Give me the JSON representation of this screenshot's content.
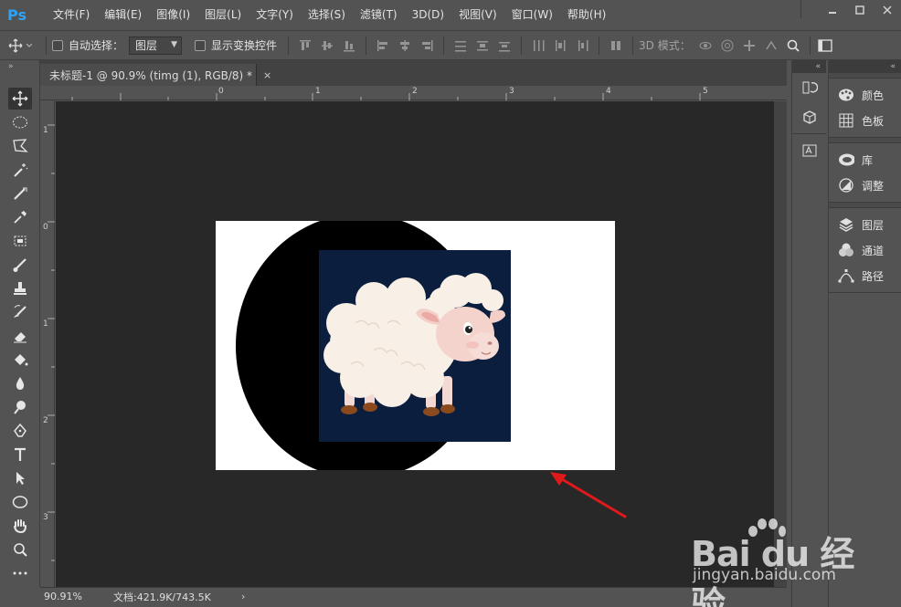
{
  "app": {
    "logo": "Ps",
    "menu": [
      "文件(F)",
      "编辑(E)",
      "图像(I)",
      "图层(L)",
      "文字(Y)",
      "选择(S)",
      "滤镜(T)",
      "3D(D)",
      "视图(V)",
      "窗口(W)",
      "帮助(H)"
    ]
  },
  "options": {
    "auto_select_label": "自动选择：",
    "layer_select_value": "图层",
    "show_transform_label": "显示变换控件",
    "mode_3d_label": "3D 模式："
  },
  "document_tab": {
    "title": "未标题-1 @ 90.9% (timg (1), RGB/8) *",
    "close": "×"
  },
  "rulers": {
    "top": [
      "0",
      "1",
      "2",
      "3",
      "4",
      "5"
    ],
    "left": [
      "1",
      "0",
      "1",
      "2",
      "3"
    ]
  },
  "status": {
    "zoom": "90.91%",
    "doc_info": "文档:421.9K/743.5K",
    "arrow": "›"
  },
  "panels": {
    "group1": [
      {
        "icon": "palette-icon",
        "label": "颜色"
      },
      {
        "icon": "swatches-icon",
        "label": "色板"
      }
    ],
    "group2": [
      {
        "icon": "libraries-icon",
        "label": "库"
      },
      {
        "icon": "adjustments-icon",
        "label": "调整"
      }
    ],
    "group3": [
      {
        "icon": "layers-icon",
        "label": "图层"
      },
      {
        "icon": "channels-icon",
        "label": "通道"
      },
      {
        "icon": "paths-icon",
        "label": "路径"
      }
    ]
  },
  "watermark": {
    "logo": "Bai du 经验",
    "site": "jingyan.baidu.com"
  },
  "colors": {
    "ui_gray": "#535353",
    "pasteboard": "#282828",
    "logo_blue": "#2fa3f6",
    "arrow_red": "#e0191b",
    "image_bg": "#0b1e3e"
  }
}
